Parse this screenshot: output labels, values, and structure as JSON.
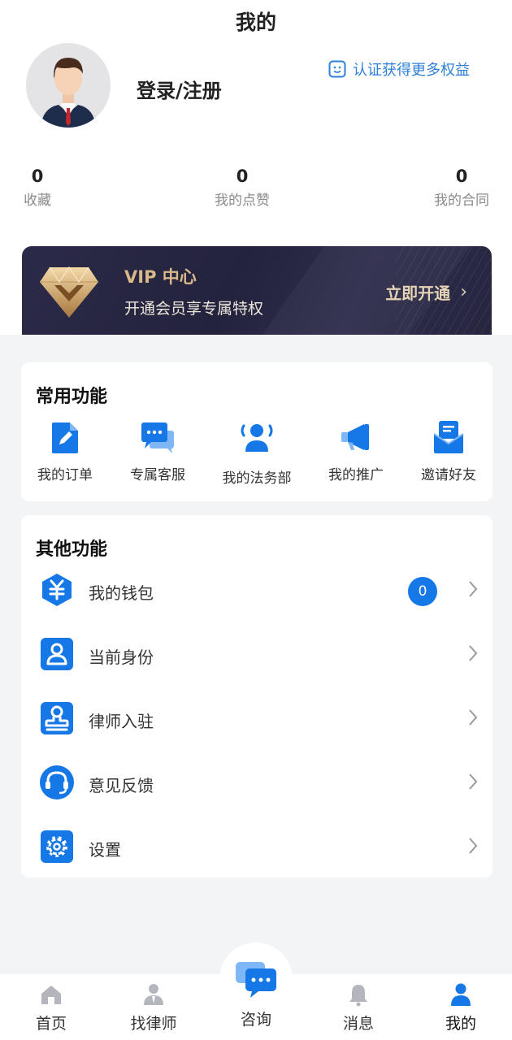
{
  "header": {
    "title": "我的"
  },
  "profile": {
    "login_label": "登录/注册",
    "verify_label": "认证获得更多权益"
  },
  "stats": [
    {
      "value": "0",
      "label": "收藏"
    },
    {
      "value": "0",
      "label": "我的点赞"
    },
    {
      "value": "0",
      "label": "我的合同"
    }
  ],
  "vip": {
    "title": "VIP 中心",
    "subtitle": "开通会员享专属特权",
    "cta": "立即开通"
  },
  "common_functions": {
    "title": "常用功能",
    "items": [
      {
        "label": "我的订单",
        "icon": "order-icon"
      },
      {
        "label": "专属客服",
        "icon": "chat-icon"
      },
      {
        "label": "我的法务部",
        "icon": "team-icon"
      },
      {
        "label": "我的推广",
        "icon": "megaphone-icon"
      },
      {
        "label": "邀请好友",
        "icon": "invite-icon"
      }
    ]
  },
  "other_functions": {
    "title": "其他功能",
    "items": [
      {
        "label": "我的钱包",
        "icon": "wallet-icon",
        "badge": "0"
      },
      {
        "label": "当前身份",
        "icon": "identity-icon"
      },
      {
        "label": "律师入驻",
        "icon": "stamp-icon"
      },
      {
        "label": "意见反馈",
        "icon": "headset-icon"
      },
      {
        "label": "设置",
        "icon": "gear-icon"
      }
    ]
  },
  "tabbar": {
    "items": [
      {
        "label": "首页",
        "icon": "home-icon"
      },
      {
        "label": "找律师",
        "icon": "lawyer-icon"
      },
      {
        "label": "咨询",
        "icon": "consult-icon"
      },
      {
        "label": "消息",
        "icon": "bell-icon"
      },
      {
        "label": "我的",
        "icon": "person-icon",
        "active": true
      }
    ]
  },
  "colors": {
    "accent": "#1677e6",
    "vip_gold": "#d9b98a",
    "vip_bg": "#26253f",
    "page_bg": "#f3f4f6"
  }
}
